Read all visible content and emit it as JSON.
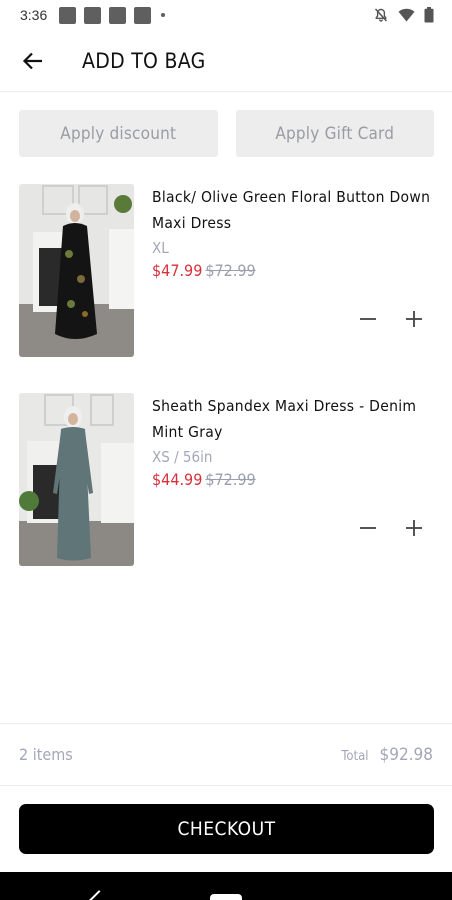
{
  "status_bar": {
    "time": "3:36"
  },
  "header": {
    "title": "ADD TO BAG"
  },
  "actions": {
    "discount_label": "Apply discount",
    "gift_card_label": "Apply Gift Card"
  },
  "items": [
    {
      "name": "Black/ Olive Green Floral Button Down Maxi Dress",
      "variant": "XL",
      "price": "$47.99",
      "original_price": "$72.99",
      "image": "dress-black-floral"
    },
    {
      "name": "Sheath Spandex Maxi Dress - Denim Mint Gray",
      "variant": "XS / 56in",
      "price": "$44.99",
      "original_price": "$72.99",
      "image": "dress-denim-mint-gray"
    }
  ],
  "summary": {
    "count": "2 items",
    "total_label": "Total",
    "total_value": "$92.98"
  },
  "checkout": {
    "label": "CHECKOUT"
  },
  "colors": {
    "sale": "#d9303b",
    "muted": "#a4a7b8",
    "button_bg": "#ededee",
    "checkout_bg": "#000000"
  }
}
